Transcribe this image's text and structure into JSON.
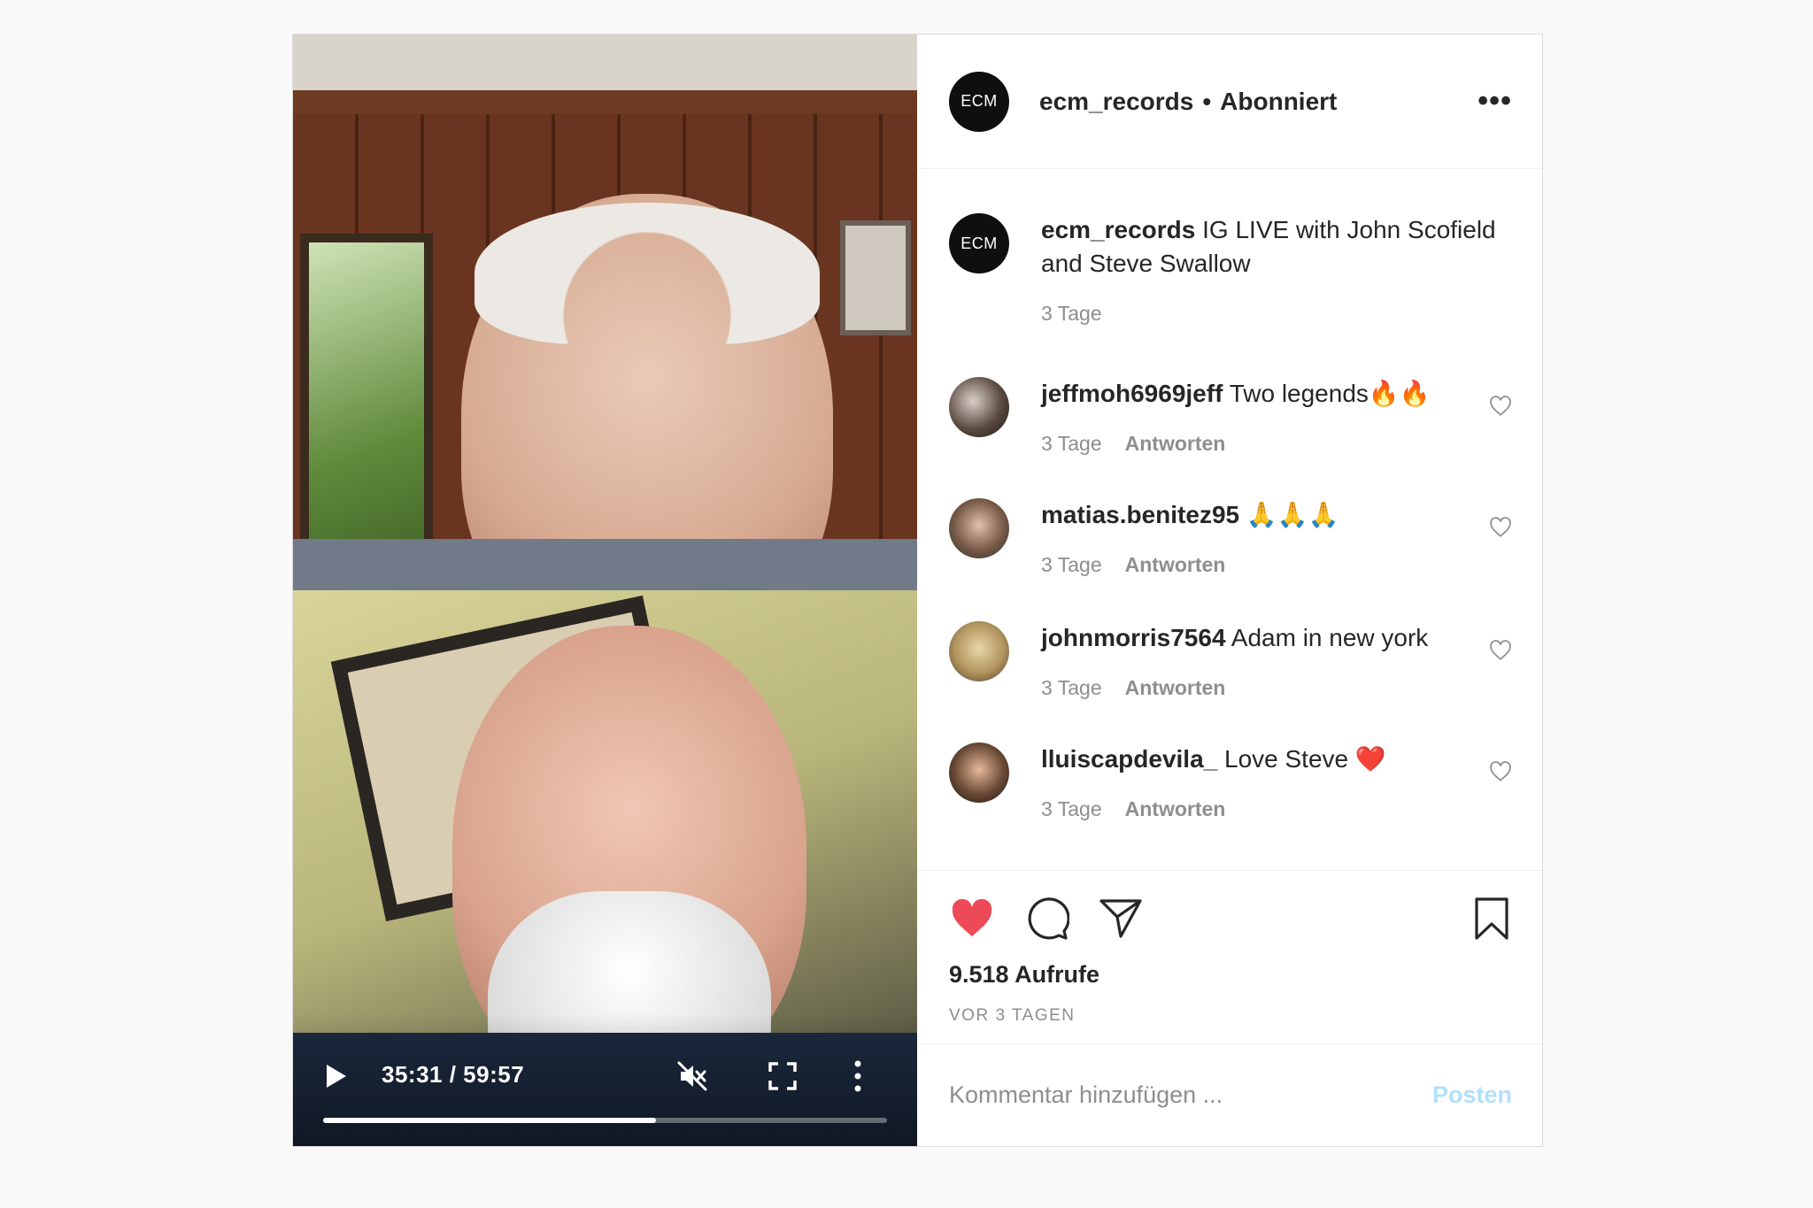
{
  "video": {
    "time": "35:31 / 59:57",
    "progress": 0.59
  },
  "header": {
    "avatar_text": "ECM",
    "username": "ecm_records",
    "separator": "•",
    "follow_status": "Abonniert",
    "more": "•••"
  },
  "caption": {
    "avatar_text": "ECM",
    "username": "ecm_records",
    "text": "IG LIVE with John Scofield and Steve Swallow",
    "time": "3 Tage"
  },
  "comments": [
    {
      "username": "jeffmoh6969jeff",
      "text": "Two legends🔥🔥",
      "time": "3 Tage",
      "reply": "Antworten"
    },
    {
      "username": "matias.benitez95",
      "text": "🙏🙏🙏",
      "time": "3 Tage",
      "reply": "Antworten"
    },
    {
      "username": "johnmorris7564",
      "text": "Adam in new york",
      "time": "3 Tage",
      "reply": "Antworten"
    },
    {
      "username": "lluiscapdevila_",
      "text": "Love Steve ❤️",
      "time": "3 Tage",
      "reply": "Antworten"
    }
  ],
  "stats": {
    "views": "9.518 Aufrufe",
    "posted": "VOR 3 TAGEN"
  },
  "comment_box": {
    "placeholder": "Kommentar hinzufügen ...",
    "post_label": "Posten"
  },
  "colors": {
    "like": "#ed4956",
    "post_button_disabled": "#b2dffc",
    "muted_text": "#8e8e8e"
  }
}
